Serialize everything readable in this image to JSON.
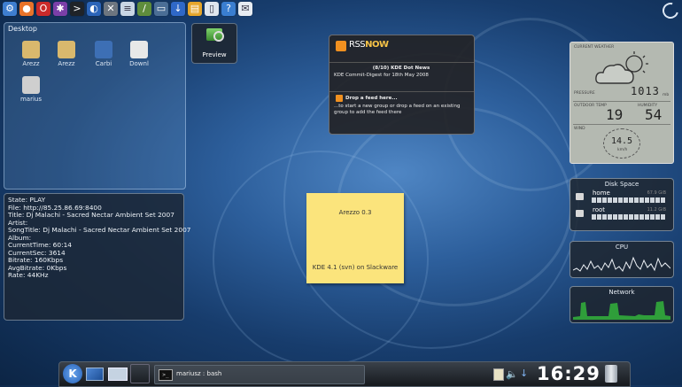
{
  "topbar_icons": [
    {
      "name": "kde-menu-icon",
      "color": "#3e7ed0",
      "glyph": "⚙"
    },
    {
      "name": "firefox-icon",
      "color": "#e8732a",
      "glyph": "●"
    },
    {
      "name": "opera-icon",
      "color": "#c92a2a",
      "glyph": "O"
    },
    {
      "name": "media-icon",
      "color": "#7a3fa8",
      "glyph": "✱"
    },
    {
      "name": "terminal-icon",
      "color": "#1f2328",
      "glyph": ">"
    },
    {
      "name": "network-icon",
      "color": "#2b64b8",
      "glyph": "◐"
    },
    {
      "name": "tools-icon",
      "color": "#6d7680",
      "glyph": "✕"
    },
    {
      "name": "document-icon",
      "color": "#c9d6e4",
      "glyph": "≡"
    },
    {
      "name": "brush-icon",
      "color": "#5f8d3c",
      "glyph": "/"
    },
    {
      "name": "monitor-icon",
      "color": "#4b6e96",
      "glyph": "▭"
    },
    {
      "name": "download-icon",
      "color": "#2f68c7",
      "glyph": "↓"
    },
    {
      "name": "notes-icon",
      "color": "#e6a62b",
      "glyph": "▤"
    },
    {
      "name": "paper-icon",
      "color": "#dfe6ee",
      "glyph": "▯"
    },
    {
      "name": "chat-icon",
      "color": "#3a7ed0",
      "glyph": "?"
    },
    {
      "name": "mail-icon",
      "color": "#e7ecf2",
      "glyph": "✉"
    }
  ],
  "desktop": {
    "title": "Desktop",
    "icons": [
      {
        "label": "Arezz",
        "color": "#d9b86d"
      },
      {
        "label": "Arezz",
        "color": "#d9b86d"
      },
      {
        "label": "Carbi",
        "color": "#3d6fb5"
      },
      {
        "label": "Downl",
        "color": "#e8e8e8"
      },
      {
        "label": "marius",
        "color": "#cfcfcf"
      }
    ]
  },
  "preview": {
    "label": "Preview"
  },
  "player": {
    "lines": [
      "State: PLAY",
      "File: http://85.25.86.69:8400",
      "Title: Dj Malachi - Sacred Nectar Ambient Set 2007",
      "Artist:",
      "SongTitle: Dj Malachi - Sacred Nectar Ambient Set 2007",
      "Album:",
      "CurrentTime: 60:14",
      "CurrentSec: 3614",
      "Bitrate: 160Kbps",
      "AvgBitrate: 0Kbps",
      "Rate: 44KHz"
    ]
  },
  "rss": {
    "brand_prefix": "RSS",
    "brand_suffix": "NOW",
    "item_title": "(8/10) KDE Dot News",
    "item_text": "KDE Commit-Digest for 18th May 2008",
    "drop_title": "Drop a feed here...",
    "drop_text": "...to start a new group or drop a feed on an existing group to add the feed there"
  },
  "note": {
    "title": "Arezzo 0.3",
    "body": "KDE 4.1 (svn) on Slackware"
  },
  "weather": {
    "header": "CURRENT WEATHER",
    "pressure_label": "PRESSURE",
    "pressure": "1013",
    "pressure_unit": "mb",
    "outdoor_label": "OUTDOOR TEMP",
    "outdoor": "19",
    "humidity_label": "HUMIDITY",
    "humidity": "54",
    "wind_label": "WIND",
    "wind": "14.5",
    "wind_unit": "km/h"
  },
  "disk": {
    "title": "Disk Space",
    "items": [
      {
        "name": "home",
        "size": "67.9 GiB"
      },
      {
        "name": "root",
        "size": "11.2 GiB"
      }
    ]
  },
  "cpu": {
    "title": "CPU"
  },
  "network": {
    "title": "Network"
  },
  "taskbar": {
    "task_label": "mariusz : bash",
    "clock": "16:29"
  }
}
